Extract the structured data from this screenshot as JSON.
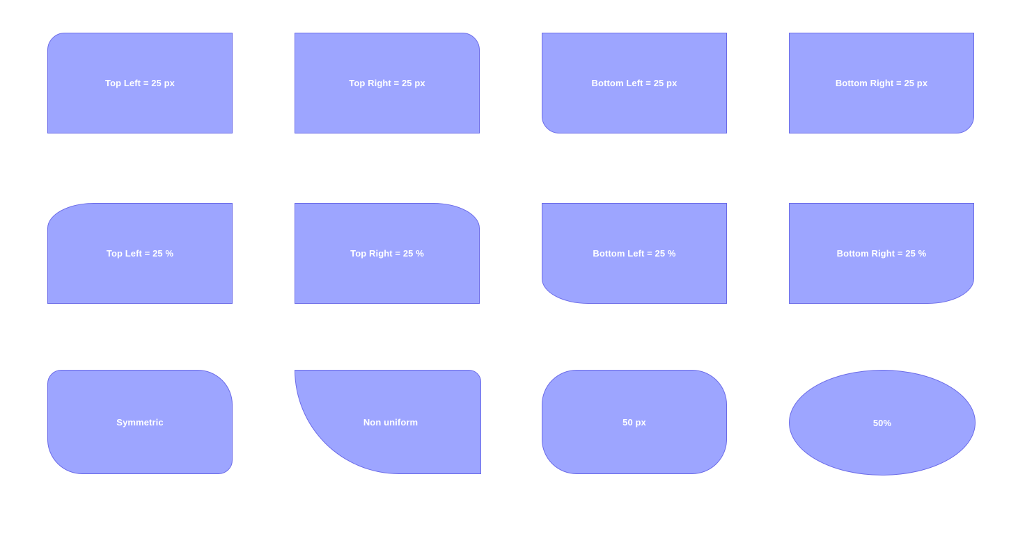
{
  "page": {
    "background_color": "#ffffff",
    "shape_fill_color": "#9da5ff",
    "shape_border_color": "#6b6be8",
    "label_color": "#ffffff"
  },
  "rows": [
    {
      "name": "absolute-pixel-radii",
      "shapes": [
        {
          "label": "Top Left = 25 px",
          "corner": "top-left",
          "radius": "25px"
        },
        {
          "label": "Top Right = 25 px",
          "corner": "top-right",
          "radius": "25px"
        },
        {
          "label": "Bottom Left = 25 px",
          "corner": "bottom-left",
          "radius": "25px"
        },
        {
          "label": "Bottom Right = 25 px",
          "corner": "bottom-right",
          "radius": "25px"
        }
      ]
    },
    {
      "name": "percentage-radii",
      "shapes": [
        {
          "label": "Top Left = 25 %",
          "corner": "top-left",
          "radius": "25%"
        },
        {
          "label": "Top Right = 25 %",
          "corner": "top-right",
          "radius": "25%"
        },
        {
          "label": "Bottom Left = 25 %",
          "corner": "bottom-left",
          "radius": "25%"
        },
        {
          "label": "Bottom Right = 25 %",
          "corner": "bottom-right",
          "radius": "25%"
        }
      ]
    },
    {
      "name": "special-shapes",
      "shapes": [
        {
          "label": "Symmetric",
          "corner": "all",
          "radius": "20px 50px 20px 50px"
        },
        {
          "label": "Non uniform",
          "corner": "all",
          "radius": "0 30px 0 260px"
        },
        {
          "label": "50 px",
          "corner": "all",
          "radius": "50px"
        },
        {
          "label": "50%",
          "corner": "all",
          "radius": "50%"
        }
      ]
    }
  ]
}
